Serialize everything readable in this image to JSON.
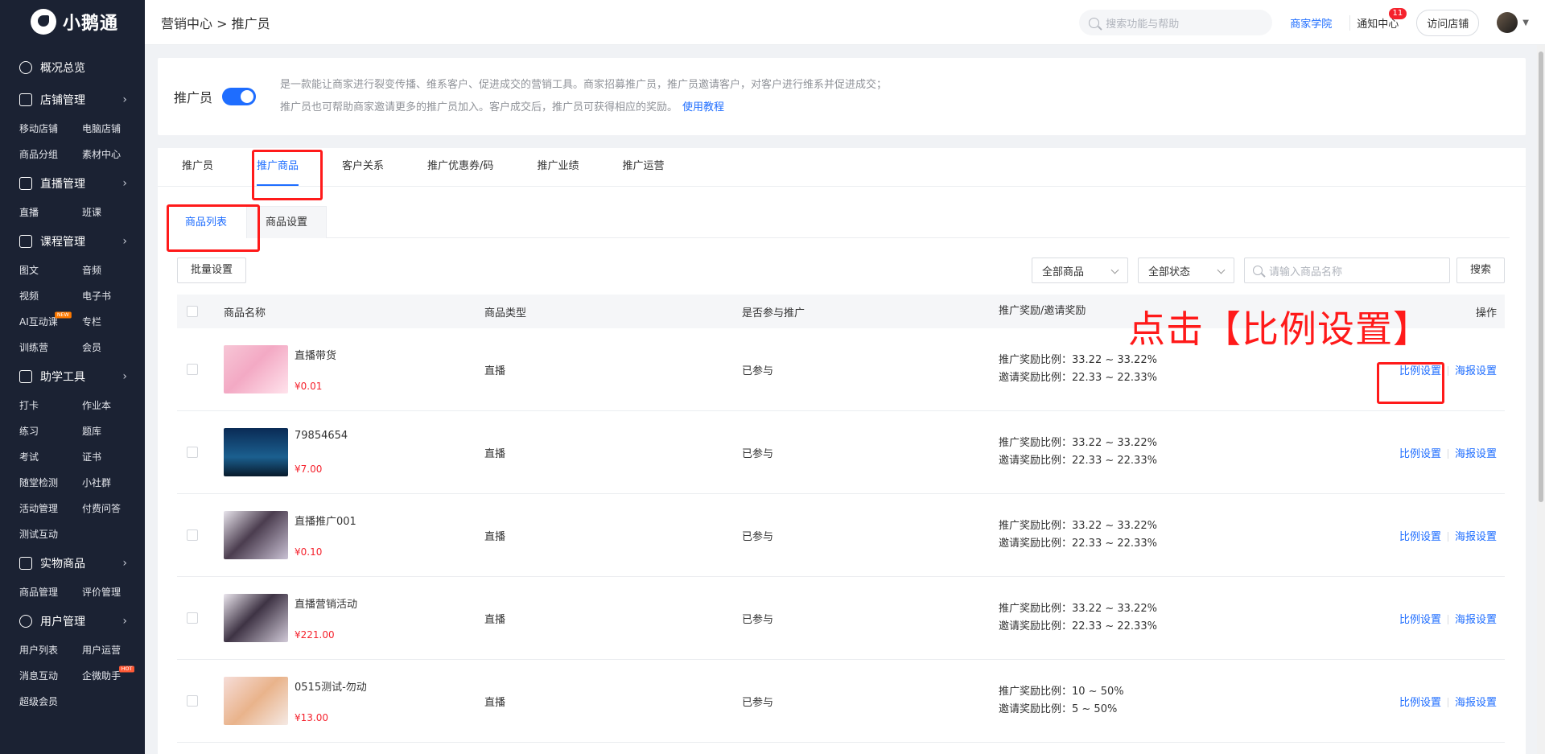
{
  "sidebar": {
    "brand": "小鹅通",
    "sections": [
      {
        "label": "概况总览",
        "icon": "dashboard-icon",
        "items": []
      },
      {
        "label": "店铺管理",
        "icon": "store-icon",
        "items": [
          "移动店铺",
          "电脑店铺",
          "商品分组",
          "素材中心"
        ]
      },
      {
        "label": "直播管理",
        "icon": "live-icon",
        "items": [
          "直播",
          "班课"
        ]
      },
      {
        "label": "课程管理",
        "icon": "course-icon",
        "items": [
          "图文",
          "音频",
          "视频",
          "电子书",
          "AI互动课",
          "专栏",
          "训练营",
          "会员"
        ]
      },
      {
        "label": "助学工具",
        "icon": "tools-icon",
        "items": [
          "打卡",
          "作业本",
          "练习",
          "题库",
          "考试",
          "证书",
          "随堂检测",
          "小社群",
          "活动管理",
          "付费问答",
          "测试互动"
        ]
      },
      {
        "label": "实物商品",
        "icon": "goods-icon",
        "items": [
          "商品管理",
          "评价管理"
        ]
      },
      {
        "label": "用户管理",
        "icon": "user-icon",
        "items": [
          "用户列表",
          "用户运营",
          "消息互动",
          "企微助手",
          "超级会员"
        ]
      }
    ],
    "badges": {
      "new": "NEW",
      "hot": "HOT"
    }
  },
  "topbar": {
    "breadcrumb": "营销中心 > 推广员",
    "search_placeholder": "搜索功能与帮助",
    "academy": "商家学院",
    "notice": "通知中心",
    "notice_count": "11",
    "visit_store": "访问店铺"
  },
  "intro": {
    "title": "推广员",
    "desc_line1": "是一款能让商家进行裂变传播、维系客户、促进成交的营销工具。商家招募推广员，推广员邀请客户，对客户进行维系并促进成交；",
    "desc_line2": "推广员也可帮助商家邀请更多的推广员加入。客户成交后，推广员可获得相应的奖励。",
    "tutorial": "使用教程"
  },
  "main_tabs": [
    "推广员",
    "推广商品",
    "客户关系",
    "推广优惠券/码",
    "推广业绩",
    "推广运营"
  ],
  "sub_tabs": [
    "商品列表",
    "商品设置"
  ],
  "toolbar": {
    "batch": "批量设置",
    "filter_goods": "全部商品",
    "filter_status": "全部状态",
    "search_placeholder": "请输入商品名称",
    "search_btn": "搜索"
  },
  "table": {
    "headers": [
      "商品名称",
      "商品类型",
      "是否参与推广",
      "推广奖励/邀请奖励",
      "操作"
    ],
    "rows": [
      {
        "name": "直播带货",
        "price": "¥0.01",
        "type": "直播",
        "join": "已参与",
        "promo": "推广奖励比例：33.22 ~ 33.22%",
        "invite": "邀请奖励比例：22.33 ~ 22.33%"
      },
      {
        "name": "79854654",
        "price": "¥7.00",
        "type": "直播",
        "join": "已参与",
        "promo": "推广奖励比例：33.22 ~ 33.22%",
        "invite": "邀请奖励比例：22.33 ~ 22.33%"
      },
      {
        "name": "直播推广001",
        "price": "¥0.10",
        "type": "直播",
        "join": "已参与",
        "promo": "推广奖励比例：33.22 ~ 33.22%",
        "invite": "邀请奖励比例：22.33 ~ 22.33%"
      },
      {
        "name": "直播营销活动",
        "price": "¥221.00",
        "type": "直播",
        "join": "已参与",
        "promo": "推广奖励比例：33.22 ~ 33.22%",
        "invite": "邀请奖励比例：22.33 ~ 22.33%"
      },
      {
        "name": "0515测试-勿动",
        "price": "¥13.00",
        "type": "直播",
        "join": "已参与",
        "promo": "推广奖励比例：10 ~ 50%",
        "invite": "邀请奖励比例：5 ~ 50%"
      }
    ],
    "op_ratio": "比例设置",
    "op_poster": "海报设置"
  },
  "annotation": {
    "text": "点击【比例设置】",
    "color": "#ff1a1a"
  },
  "colors": {
    "accent": "#1e6dff",
    "sidebar": "#1b2233",
    "price": "#f5222d"
  }
}
